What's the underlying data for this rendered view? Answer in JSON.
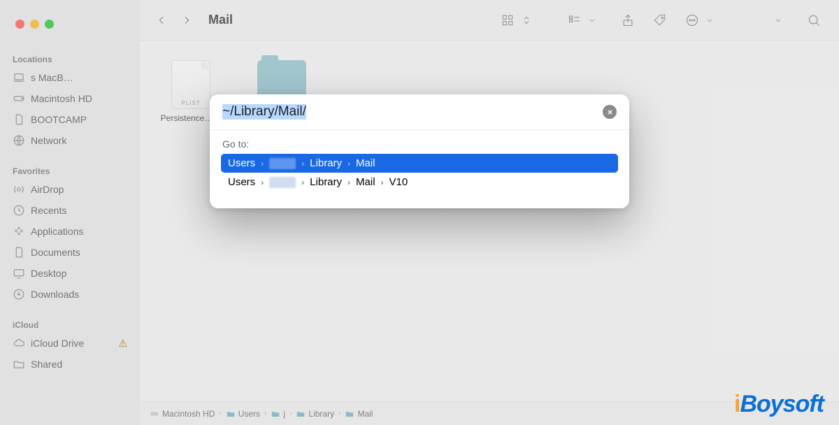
{
  "window": {
    "title": "Mail"
  },
  "sidebar": {
    "sections": [
      {
        "label": "Locations",
        "items": [
          {
            "label": "s MacB…",
            "icon": "laptop"
          },
          {
            "label": "Macintosh HD",
            "icon": "disk"
          },
          {
            "label": "BOOTCAMP",
            "icon": "doc"
          },
          {
            "label": "Network",
            "icon": "globe"
          }
        ]
      },
      {
        "label": "Favorites",
        "items": [
          {
            "label": "AirDrop",
            "icon": "airdrop"
          },
          {
            "label": "Recents",
            "icon": "clock"
          },
          {
            "label": "Applications",
            "icon": "apps"
          },
          {
            "label": "Documents",
            "icon": "doc"
          },
          {
            "label": "Desktop",
            "icon": "desktop"
          },
          {
            "label": "Downloads",
            "icon": "download"
          }
        ]
      },
      {
        "label": "iCloud",
        "items": [
          {
            "label": "iCloud Drive",
            "icon": "cloud",
            "warn": true
          },
          {
            "label": "Shared",
            "icon": "shared"
          }
        ]
      }
    ]
  },
  "content": {
    "items": [
      {
        "name": "Persistence…ist",
        "badge": "PLIST",
        "type": "plist"
      },
      {
        "name": "",
        "type": "folder"
      }
    ]
  },
  "pathbar": {
    "segments": [
      "Macintosh HD",
      "Users",
      "j",
      "Library",
      "Mail"
    ]
  },
  "goto_dialog": {
    "input_value": "~/Library/Mail/",
    "label": "Go to:",
    "results": [
      {
        "segments": [
          "Users",
          "",
          "Library",
          "Mail"
        ],
        "selected": true
      },
      {
        "segments": [
          "Users",
          "",
          "Library",
          "Mail",
          "V10"
        ],
        "selected": false
      }
    ]
  },
  "watermark": "iBoysoft"
}
